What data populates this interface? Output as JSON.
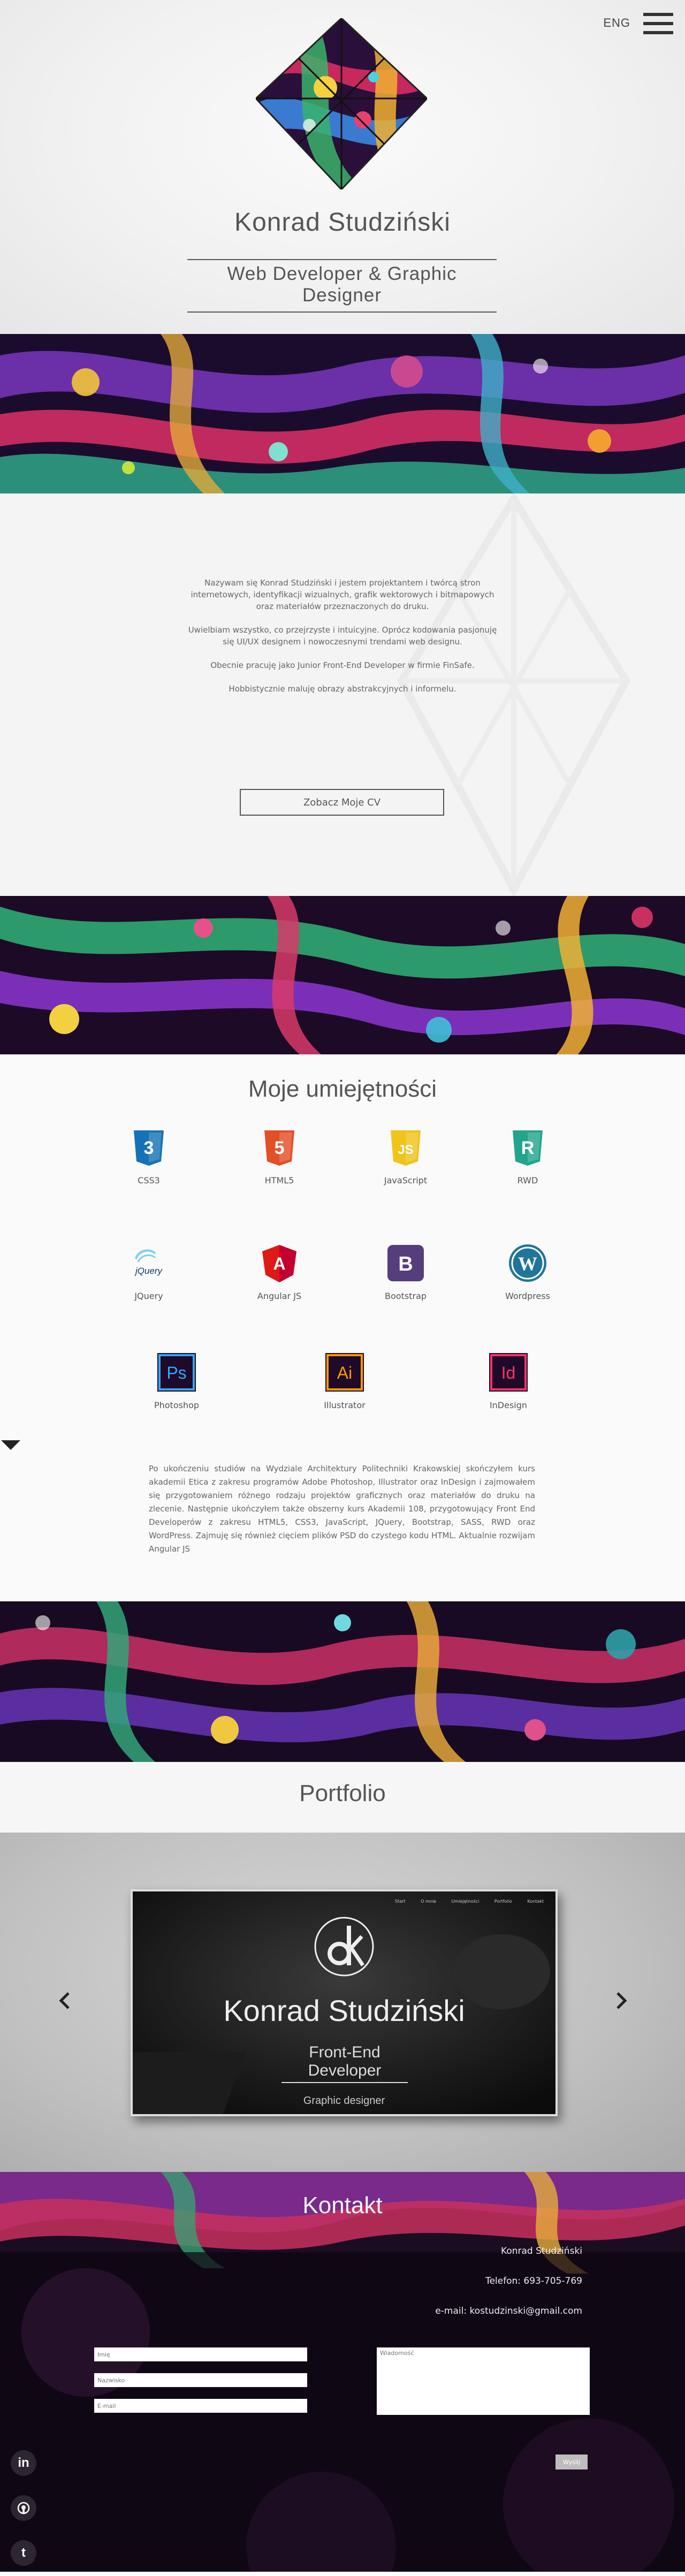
{
  "header": {
    "lang": "ENG",
    "name": "Konrad Studziński",
    "role": "Web Developer & Graphic Designer"
  },
  "about": {
    "paragraphs": [
      "Nazywam się Konrad Studziński i jestem projektantem i twórcą stron internetowych, identyfikacji wizualnych, grafik wektorowych i bitmapowych oraz materiałów przeznaczonych do druku.",
      "Uwielbiam wszystko, co przejrzyste i intuicyjne. Oprócz kodowania pasjonuję się UI/UX designem i nowoczesnymi trendami web designu.",
      "Obecnie pracuję jako Junior Front-End Developer w firmie FinSafe.",
      "Hobbistycznie maluję obrazy abstrakcyjnych i informelu."
    ],
    "cv_button": "Zobacz Moje CV"
  },
  "skills": {
    "title": "Moje umiejętności",
    "items": [
      {
        "label": "CSS3",
        "icon": "css3-icon",
        "color": "#1572b6",
        "glyph": "3"
      },
      {
        "label": "HTML5",
        "icon": "html5-icon",
        "color": "#e34f26",
        "glyph": "5"
      },
      {
        "label": "JavaScript",
        "icon": "javascript-icon",
        "color": "#f0c419",
        "glyph": "JS"
      },
      {
        "label": "RWD",
        "icon": "rwd-icon",
        "color": "#21a58d",
        "glyph": "R"
      },
      {
        "label": "JQuery",
        "icon": "jquery-icon",
        "color": "#0b3c66",
        "glyph": "jQuery"
      },
      {
        "label": "Angular JS",
        "icon": "angular-icon",
        "color": "#c3002f",
        "glyph": "A"
      },
      {
        "label": "Bootstrap",
        "icon": "bootstrap-icon",
        "color": "#563d7c",
        "glyph": "B"
      },
      {
        "label": "Wordpress",
        "icon": "wordpress-icon",
        "color": "#21759b",
        "glyph": "W"
      },
      {
        "label": "Photoshop",
        "icon": "photoshop-icon",
        "color": "#31a8ff",
        "glyph": "Ps"
      },
      {
        "label": "Illustrator",
        "icon": "illustrator-icon",
        "color": "#ff9a00",
        "glyph": "Ai"
      },
      {
        "label": "InDesign",
        "icon": "indesign-icon",
        "color": "#ff3366",
        "glyph": "Id"
      }
    ],
    "description": "Po ukończeniu studiów na Wydziale Architektury Politechniki Krakowskiej skończyłem kurs akademii Etica z zakresu programów Adobe Photoshop, Illustrator oraz InDesign i zajmowałem się przygotowaniem różnego rodzaju projektów graficznych oraz materiałów do druku na zlecenie. Następnie ukończyłem także obszerny kurs Akademii 108, przygotowujący Front End Developerów z zakresu HTML5, CSS3, JavaScript, JQuery, Bootstrap, SASS, RWD oraz WordPress. Zajmuję się również cięciem plików PSD do czystego kodu HTML. Aktualnie rozwijam Angular JS"
  },
  "portfolio": {
    "title": "Portfolio",
    "slide": {
      "nav": [
        "Start",
        "O mnie",
        "Umiejętności",
        "Portfolio",
        "Kontakt"
      ],
      "name": "Konrad Studziński",
      "role": "Front-End Developer",
      "sub": "Graphic designer"
    }
  },
  "contact": {
    "title": "Kontakt",
    "name": "Konrad Studziński",
    "phone": "Telefon: 693-705-769",
    "email": "e-mail: kostudzinski@gmail.com",
    "fields": {
      "first_name": "Imię",
      "last_name": "Nazwisko",
      "email": "E-mail",
      "message": "Wiadomość"
    },
    "send": "Wyślij"
  },
  "social": {
    "linkedin": "in",
    "github": "github",
    "tumblr": "t"
  }
}
